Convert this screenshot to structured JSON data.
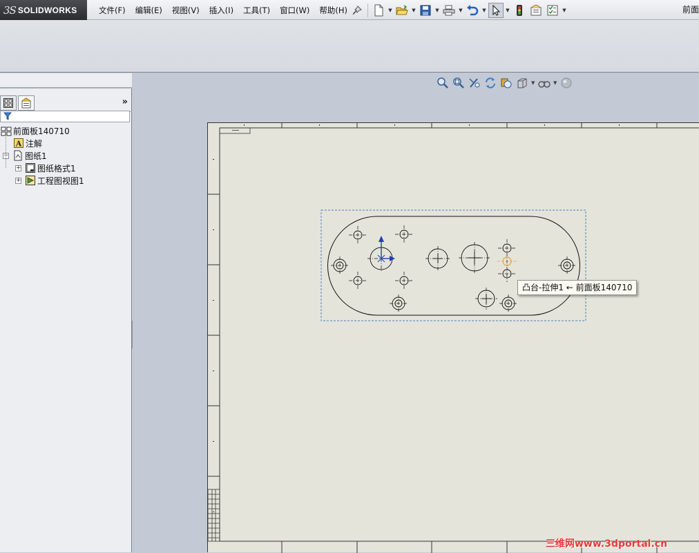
{
  "app": {
    "logo_text": "SOLIDWORKS",
    "logo_mark": "3S",
    "doc_title": "前面"
  },
  "menu": [
    {
      "label": "文件(F)"
    },
    {
      "label": "编辑(E)"
    },
    {
      "label": "视图(V)"
    },
    {
      "label": "插入(I)"
    },
    {
      "label": "工具(T)"
    },
    {
      "label": "窗口(W)"
    },
    {
      "label": "帮助(H)"
    }
  ],
  "toolbar_icons": [
    "pushpin-icon",
    "new-document-icon",
    "open-folder-icon",
    "save-icon",
    "print-icon",
    "undo-icon",
    "select-arrow-icon",
    "rebuild-traffic-light-icon",
    "file-properties-icon",
    "options-icon"
  ],
  "tree": {
    "root": "前面板140710",
    "items": [
      {
        "label": "注解",
        "icon": "annotation-icon"
      },
      {
        "label": "图纸1",
        "icon": "sheet-icon"
      },
      {
        "label": "图纸格式1",
        "icon": "sheet-format-icon"
      },
      {
        "label": "工程图视图1",
        "icon": "drawing-view-icon"
      }
    ]
  },
  "view_toolbar_icons": [
    "zoom-to-fit-icon",
    "zoom-to-area-icon",
    "previous-view-icon",
    "rebuild-icon",
    "display-style-icon",
    "view-orientation-icon",
    "hide-show-icon",
    "appearance-icon"
  ],
  "tooltip": {
    "text": "凸台-拉伸1 ← 前面板140710"
  },
  "watermark": {
    "text": "三维网www.3dportal.cn"
  },
  "colors": {
    "sheet": "#e5e4da",
    "background": "#c3c9d5",
    "selection_box": "#4a7fc0",
    "highlight": "#e8a040",
    "watermark": "#e23b3b"
  }
}
